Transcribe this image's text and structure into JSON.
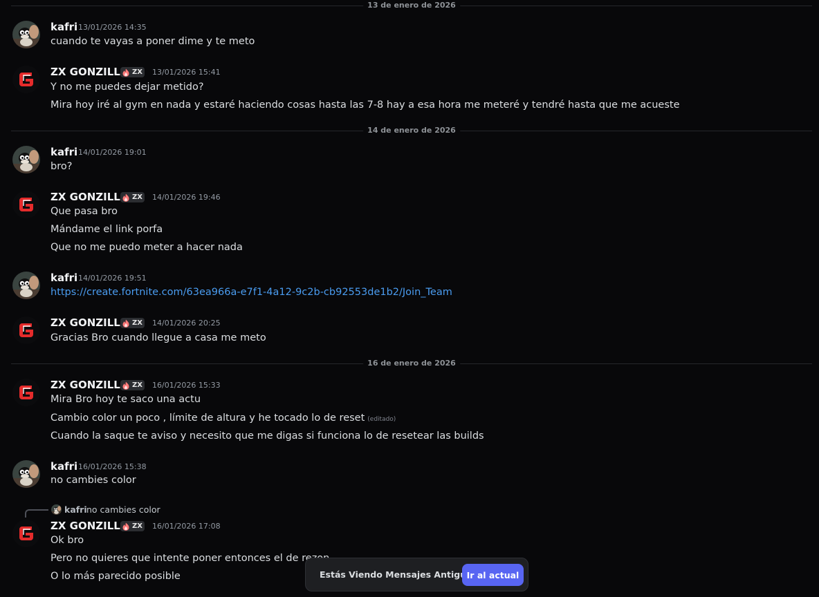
{
  "dividers": [
    "13 de enero de 2026",
    "14 de enero de 2026",
    "16 de enero de 2026"
  ],
  "users": {
    "kafri": {
      "name": "kafri"
    },
    "gonzillo": {
      "name": "ZX GONZILLO",
      "tag": "ZX"
    }
  },
  "messages": [
    {
      "author": "kafri",
      "time": "13/01/2026 14:35",
      "lines": [
        "cuando te vayas a poner dime y te meto"
      ]
    },
    {
      "author": "ZX GONZILLO",
      "time": "13/01/2026 15:41",
      "lines": [
        "Y no me puedes dejar metido?",
        "Mira hoy iré al gym en nada y estaré haciendo cosas hasta las 7-8 hay a esa hora me meteré y tendré hasta que me acueste"
      ]
    },
    {
      "author": "kafri",
      "time": "14/01/2026 19:01",
      "lines": [
        "bro?"
      ]
    },
    {
      "author": "ZX GONZILLO",
      "time": "14/01/2026 19:46",
      "lines": [
        "Que pasa bro",
        "Mándame el link porfa",
        "Que no me puedo meter a hacer nada"
      ]
    },
    {
      "author": "kafri",
      "time": "14/01/2026 19:51",
      "lines": [
        "https://create.fortnite.com/63ea966a-e7f1-4a12-9c2b-cb92553de1b2/Join_Team"
      ]
    },
    {
      "author": "ZX GONZILLO",
      "time": "14/01/2026 20:25",
      "lines": [
        "Gracias Bro cuando llegue a casa me meto"
      ]
    },
    {
      "author": "ZX GONZILLO",
      "time": "16/01/2026 15:33",
      "lines": [
        "Mira Bro hoy te saco una actu",
        "Cambio color un poco , límite de altura y he tocado lo de reset",
        "Cuando la saque te aviso y necesito que me digas si funciona lo de resetear las builds"
      ],
      "edited_label": "(editado)"
    },
    {
      "author": "kafri",
      "time": "16/01/2026 15:38",
      "lines": [
        "no cambies color"
      ]
    },
    {
      "author": "ZX GONZILLO",
      "time": "16/01/2026 17:08",
      "lines": [
        "Ok bro",
        "Pero no quieres que intente poner entonces el de rezon",
        "O lo más parecido posible"
      ],
      "reply": {
        "author": "kafri",
        "text": "no cambies color"
      }
    }
  ],
  "jump_bar": {
    "text": "Estás Viendo Mensajes Antiguos",
    "button": "Ir al actual"
  },
  "colors": {
    "background": "#08080a",
    "link": "#4a9cf0",
    "accent": "#5865f2",
    "gonzillo_logo": "#e52b2b"
  },
  "icons": {
    "badge": "flame-icon",
    "kafri_avatar": "mascot-avatar",
    "gonzillo_avatar": "red-g-logo-avatar"
  }
}
